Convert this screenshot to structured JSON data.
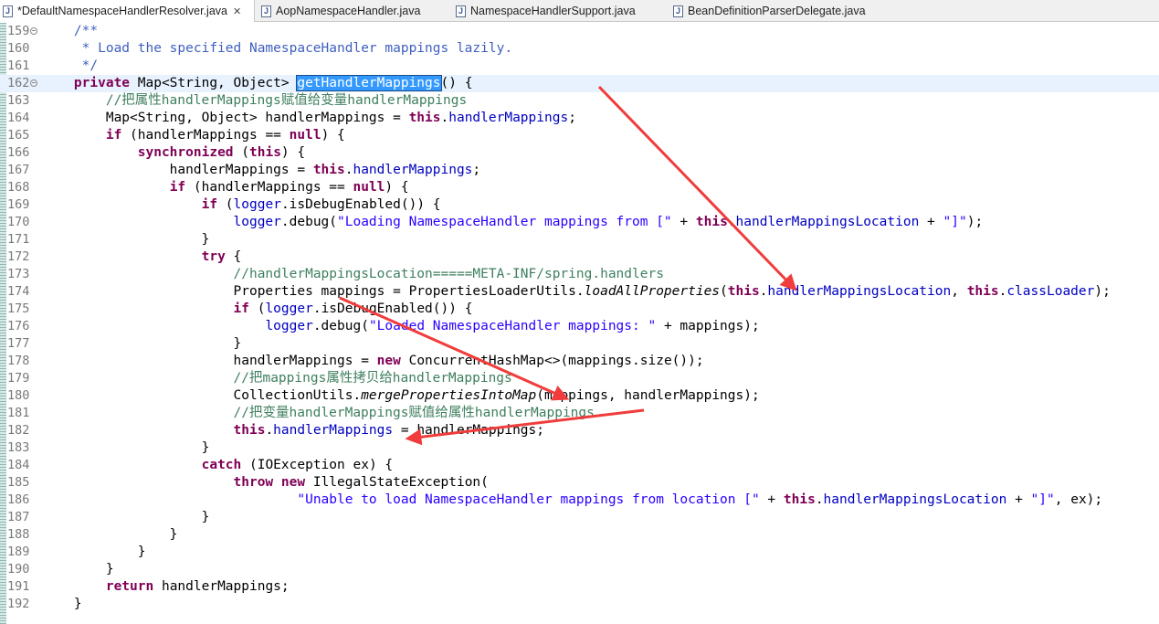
{
  "tabs": [
    {
      "label": "*DefaultNamespaceHandlerResolver.java",
      "close": "✕",
      "icon": "J"
    },
    {
      "label": "AopNamespaceHandler.java",
      "icon": "J"
    },
    {
      "label": "NamespaceHandlerSupport.java",
      "icon": "J"
    },
    {
      "label": "BeanDefinitionParserDelegate.java",
      "icon": "J"
    }
  ],
  "editor": {
    "lines": [
      {
        "n": "159",
        "fold": "−",
        "t": [
          [
            "    ",
            ""
          ],
          [
            "/**",
            "jd"
          ]
        ]
      },
      {
        "n": "160",
        "t": [
          [
            "     * Load the specified NamespaceHandler mappings lazily.",
            "jd"
          ]
        ]
      },
      {
        "n": "161",
        "t": [
          [
            "     */",
            "jd"
          ]
        ]
      },
      {
        "n": "162",
        "fold": "−",
        "cur": true,
        "t": [
          [
            "    ",
            ""
          ],
          [
            "private",
            "kw"
          ],
          [
            " Map<String, Object> ",
            ""
          ],
          [
            "getHandlerMappings",
            "sel"
          ],
          [
            "() {",
            ""
          ]
        ]
      },
      {
        "n": "163",
        "t": [
          [
            "        ",
            ""
          ],
          [
            "//把属性handlerMappings赋值给变量handlerMappings",
            "cm"
          ]
        ]
      },
      {
        "n": "164",
        "t": [
          [
            "        Map<String, Object> handlerMappings = ",
            ""
          ],
          [
            "this",
            "kw"
          ],
          [
            ".",
            ""
          ],
          [
            "handlerMappings",
            "fd"
          ],
          [
            ";",
            ""
          ]
        ]
      },
      {
        "n": "165",
        "t": [
          [
            "        ",
            ""
          ],
          [
            "if",
            "kw"
          ],
          [
            " (handlerMappings == ",
            ""
          ],
          [
            "null",
            "kw"
          ],
          [
            ") {",
            ""
          ]
        ]
      },
      {
        "n": "166",
        "t": [
          [
            "            ",
            ""
          ],
          [
            "synchronized",
            "kw"
          ],
          [
            " (",
            ""
          ],
          [
            "this",
            "kw"
          ],
          [
            ") {",
            ""
          ]
        ]
      },
      {
        "n": "167",
        "t": [
          [
            "                handlerMappings = ",
            ""
          ],
          [
            "this",
            "kw"
          ],
          [
            ".",
            ""
          ],
          [
            "handlerMappings",
            "fd"
          ],
          [
            ";",
            ""
          ]
        ]
      },
      {
        "n": "168",
        "t": [
          [
            "                ",
            ""
          ],
          [
            "if",
            "kw"
          ],
          [
            " (handlerMappings == ",
            ""
          ],
          [
            "null",
            "kw"
          ],
          [
            ") {",
            ""
          ]
        ]
      },
      {
        "n": "169",
        "t": [
          [
            "                    ",
            ""
          ],
          [
            "if",
            "kw"
          ],
          [
            " (",
            ""
          ],
          [
            "logger",
            "fd"
          ],
          [
            ".isDebugEnabled()) {",
            ""
          ]
        ]
      },
      {
        "n": "170",
        "t": [
          [
            "                        ",
            ""
          ],
          [
            "logger",
            "fd"
          ],
          [
            ".debug(",
            ""
          ],
          [
            "\"Loading NamespaceHandler mappings from [\"",
            "st"
          ],
          [
            " + ",
            ""
          ],
          [
            "this",
            "kw"
          ],
          [
            ".",
            ""
          ],
          [
            "handlerMappingsLocation",
            "fd"
          ],
          [
            " + ",
            ""
          ],
          [
            "\"]\"",
            "st"
          ],
          [
            ");",
            ""
          ]
        ]
      },
      {
        "n": "171",
        "t": [
          [
            "                    }",
            ""
          ]
        ]
      },
      {
        "n": "172",
        "t": [
          [
            "                    ",
            ""
          ],
          [
            "try",
            "kw"
          ],
          [
            " {",
            ""
          ]
        ]
      },
      {
        "n": "173",
        "t": [
          [
            "                        ",
            ""
          ],
          [
            "//handlerMappingsLocation=====META-INF/spring.handlers",
            "cm"
          ]
        ]
      },
      {
        "n": "174",
        "t": [
          [
            "                        Properties mappings = PropertiesLoaderUtils.",
            ""
          ],
          [
            "loadAllProperties",
            "it"
          ],
          [
            "(",
            ""
          ],
          [
            "this",
            "kw"
          ],
          [
            ".",
            ""
          ],
          [
            "handlerMappingsLocation",
            "fd"
          ],
          [
            ", ",
            ""
          ],
          [
            "this",
            "kw"
          ],
          [
            ".",
            ""
          ],
          [
            "classLoader",
            "fd"
          ],
          [
            ");",
            ""
          ]
        ]
      },
      {
        "n": "175",
        "t": [
          [
            "                        ",
            ""
          ],
          [
            "if",
            "kw"
          ],
          [
            " (",
            ""
          ],
          [
            "logger",
            "fd"
          ],
          [
            ".isDebugEnabled()) {",
            ""
          ]
        ]
      },
      {
        "n": "176",
        "t": [
          [
            "                            ",
            ""
          ],
          [
            "logger",
            "fd"
          ],
          [
            ".debug(",
            ""
          ],
          [
            "\"Loaded NamespaceHandler mappings: \"",
            "st"
          ],
          [
            " + mappings);",
            ""
          ]
        ]
      },
      {
        "n": "177",
        "t": [
          [
            "                        }",
            ""
          ]
        ]
      },
      {
        "n": "178",
        "t": [
          [
            "                        handlerMappings = ",
            ""
          ],
          [
            "new",
            "kw"
          ],
          [
            " ConcurrentHashMap<>(mappings.size());",
            ""
          ]
        ]
      },
      {
        "n": "179",
        "t": [
          [
            "                        ",
            ""
          ],
          [
            "//把mappings属性拷贝给handlerMappings",
            "cm"
          ]
        ]
      },
      {
        "n": "180",
        "t": [
          [
            "                        CollectionUtils.",
            ""
          ],
          [
            "mergePropertiesIntoMap",
            "it"
          ],
          [
            "(mappings, handlerMappings);",
            ""
          ]
        ]
      },
      {
        "n": "181",
        "t": [
          [
            "                        ",
            ""
          ],
          [
            "//把变量handlerMappings赋值给属性handlerMappings",
            "cm"
          ]
        ]
      },
      {
        "n": "182",
        "t": [
          [
            "                        ",
            ""
          ],
          [
            "this",
            "kw"
          ],
          [
            ".",
            ""
          ],
          [
            "handlerMappings",
            "fd"
          ],
          [
            " = handlerMappings;",
            ""
          ]
        ]
      },
      {
        "n": "183",
        "t": [
          [
            "                    }",
            ""
          ]
        ]
      },
      {
        "n": "184",
        "t": [
          [
            "                    ",
            ""
          ],
          [
            "catch",
            "kw"
          ],
          [
            " (IOException ex) {",
            ""
          ]
        ]
      },
      {
        "n": "185",
        "t": [
          [
            "                        ",
            ""
          ],
          [
            "throw",
            "kw"
          ],
          [
            " ",
            ""
          ],
          [
            "new",
            "kw"
          ],
          [
            " IllegalStateException(",
            ""
          ]
        ]
      },
      {
        "n": "186",
        "t": [
          [
            "                                ",
            ""
          ],
          [
            "\"Unable to load NamespaceHandler mappings from location [\"",
            "st"
          ],
          [
            " + ",
            ""
          ],
          [
            "this",
            "kw"
          ],
          [
            ".",
            ""
          ],
          [
            "handlerMappingsLocation",
            "fd"
          ],
          [
            " + ",
            ""
          ],
          [
            "\"]\"",
            "st"
          ],
          [
            ", ex);",
            ""
          ]
        ]
      },
      {
        "n": "187",
        "t": [
          [
            "                    }",
            ""
          ]
        ]
      },
      {
        "n": "188",
        "t": [
          [
            "                }",
            ""
          ]
        ]
      },
      {
        "n": "189",
        "t": [
          [
            "            }",
            ""
          ]
        ]
      },
      {
        "n": "190",
        "t": [
          [
            "        }",
            ""
          ]
        ]
      },
      {
        "n": "191",
        "t": [
          [
            "        ",
            ""
          ],
          [
            "return",
            "kw"
          ],
          [
            " handlerMappings;",
            ""
          ]
        ]
      },
      {
        "n": "192",
        "t": [
          [
            "    }",
            ""
          ]
        ]
      }
    ]
  },
  "colors": {
    "keyword": "#7f0055",
    "comment": "#3f7f5f",
    "javadoc": "#3f5fbf",
    "string": "#2a00ff",
    "field": "#0000c0",
    "selection": "#3399ff",
    "annotation_arrow": "#f03c3c"
  }
}
